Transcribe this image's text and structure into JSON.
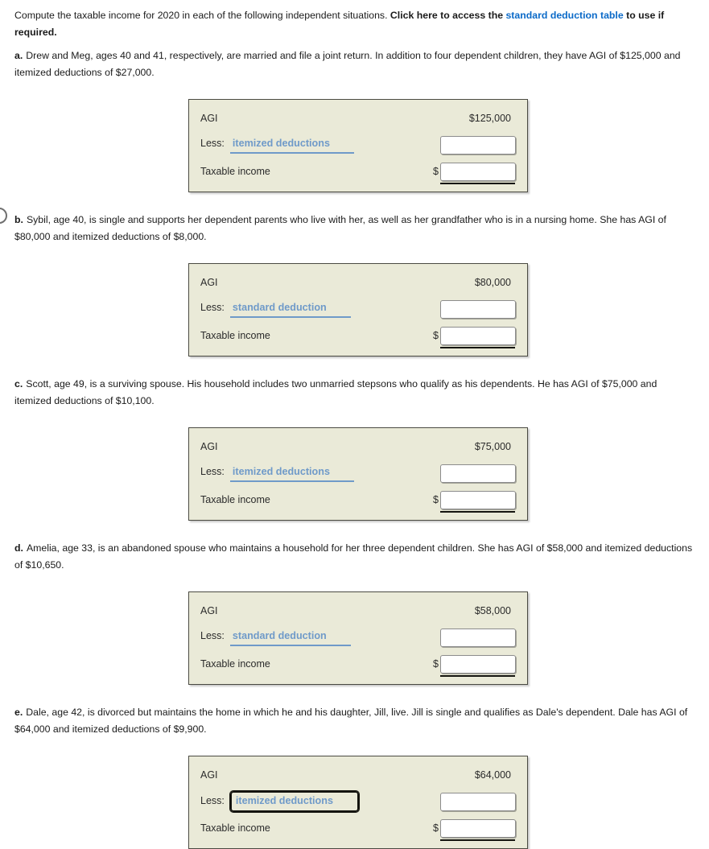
{
  "intro": {
    "text_before": "Compute the taxable income for 2020 in each of the following independent situations.",
    "bold_before_link": "Click here to access the",
    "link_text": "standard deduction table",
    "bold_after_link": "to use if required."
  },
  "situations": [
    {
      "letter": "a.",
      "text": "Drew and Meg, ages 40 and 41, respectively, are married and file a joint return. In addition to four dependent children, they have AGI of $125,000 and itemized deductions of $27,000.",
      "table": {
        "agi_label": "AGI",
        "agi_value": "$125,000",
        "less_label": "Less:",
        "deduction_selected": "itemized deductions",
        "deduction_focused": false,
        "deduction_input_value": "",
        "taxable_label": "Taxable income",
        "taxable_prefix": "$",
        "taxable_input_value": ""
      }
    },
    {
      "letter": "b.",
      "text": "Sybil, age 40, is single and supports her dependent parents who live with her, as well as her grandfather who is in a nursing home. She has AGI of $80,000 and itemized deductions of $8,000.",
      "table": {
        "agi_label": "AGI",
        "agi_value": "$80,000",
        "less_label": "Less:",
        "deduction_selected": "standard deduction",
        "deduction_focused": false,
        "deduction_input_value": "",
        "taxable_label": "Taxable income",
        "taxable_prefix": "$",
        "taxable_input_value": ""
      }
    },
    {
      "letter": "c.",
      "text": "Scott, age 49, is a surviving spouse. His household includes two unmarried stepsons who qualify as his dependents. He has AGI of $75,000 and itemized deductions of $10,100.",
      "table": {
        "agi_label": "AGI",
        "agi_value": "$75,000",
        "less_label": "Less:",
        "deduction_selected": "itemized deductions",
        "deduction_focused": false,
        "deduction_input_value": "",
        "taxable_label": "Taxable income",
        "taxable_prefix": "$",
        "taxable_input_value": ""
      }
    },
    {
      "letter": "d.",
      "text": "Amelia, age 33, is an abandoned spouse who maintains a household for her three dependent children. She has AGI of $58,000 and itemized deductions of $10,650.",
      "table": {
        "agi_label": "AGI",
        "agi_value": "$58,000",
        "less_label": "Less:",
        "deduction_selected": "standard deduction",
        "deduction_focused": false,
        "deduction_input_value": "",
        "taxable_label": "Taxable income",
        "taxable_prefix": "$",
        "taxable_input_value": ""
      }
    },
    {
      "letter": "e.",
      "text": "Dale, age 42, is divorced but maintains the home in which he and his daughter, Jill, live. Jill is single and qualifies as Dale's dependent. Dale has AGI of $64,000 and itemized deductions of $9,900.",
      "table": {
        "agi_label": "AGI",
        "agi_value": "$64,000",
        "less_label": "Less:",
        "deduction_selected": "itemized deductions",
        "deduction_focused": true,
        "deduction_input_value": "",
        "taxable_label": "Taxable income",
        "taxable_prefix": "$",
        "taxable_input_value": ""
      }
    }
  ],
  "deduction_options": [
    "standard deduction",
    "itemized deductions"
  ],
  "colors": {
    "table_background": "#eaead8",
    "table_border": "#4a4a42",
    "link_blue": "#0b6ac8",
    "dropdown_blue": "#6f9ac9",
    "text": "#1a1a1a"
  }
}
